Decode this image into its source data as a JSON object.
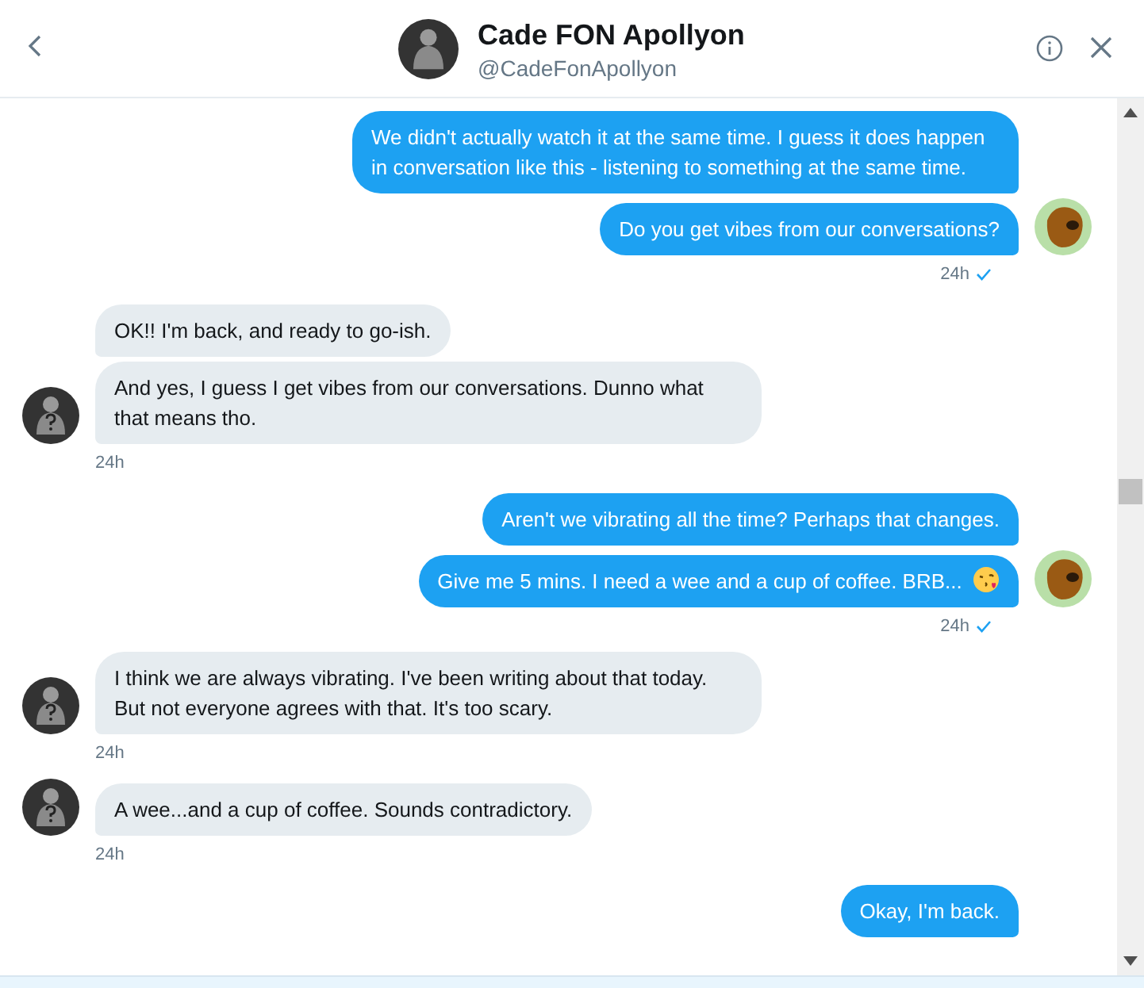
{
  "header": {
    "name": "Cade FON Apollyon",
    "handle": "@CadeFonApollyon"
  },
  "groups": [
    {
      "kind": "sent",
      "messages": [
        {
          "text": "We didn't actually watch it at the same time. I guess it does happen in conversation like this - listening to something at the same time."
        },
        {
          "text": "Do you get vibes from our conversations?"
        }
      ],
      "time": "24h",
      "read": true
    },
    {
      "kind": "received",
      "messages": [
        {
          "text": "OK!! I'm back, and ready to go-ish."
        },
        {
          "text": "And yes, I guess I get vibes from our conversations. Dunno what that means tho."
        }
      ],
      "time": "24h"
    },
    {
      "kind": "sent",
      "messages": [
        {
          "text": "Aren't we vibrating all the time? Perhaps that changes."
        },
        {
          "text": "Give me 5 mins. I need a wee and a cup of coffee. BRB...",
          "emoji": true
        }
      ],
      "time": "24h",
      "read": true
    },
    {
      "kind": "received",
      "messages": [
        {
          "text": "I think we are always vibrating. I've been writing about that today. But not everyone agrees with that. It's too scary."
        }
      ],
      "time": "24h"
    },
    {
      "kind": "received",
      "messages": [
        {
          "text": "A wee...and a cup of coffee. Sounds contradictory."
        }
      ],
      "time": "24h"
    },
    {
      "kind": "sent",
      "messages": [
        {
          "text": "Okay, I'm back."
        }
      ]
    }
  ]
}
